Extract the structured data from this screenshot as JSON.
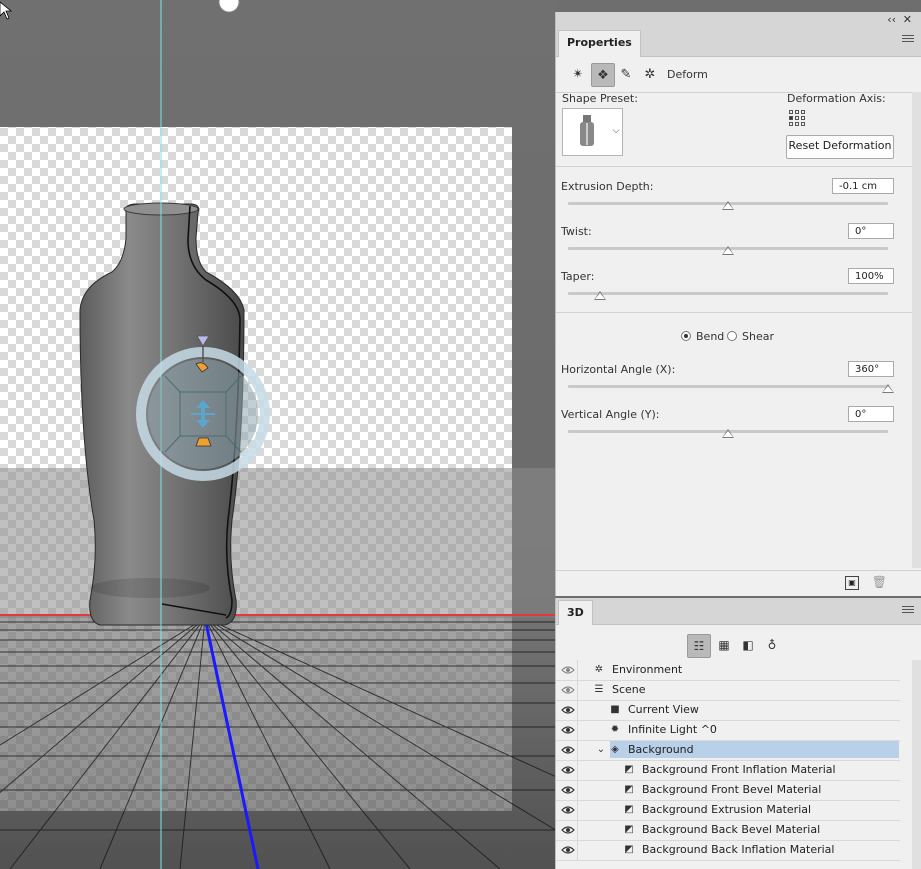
{
  "properties": {
    "tab_label": "Properties",
    "mode_label": "Deform",
    "shape_preset_label": "Shape Preset:",
    "deformation_axis_label": "Deformation Axis:",
    "reset_button": "Reset Deformation",
    "extrusion_depth": {
      "label": "Extrusion Depth:",
      "value": "-0.1 cm",
      "slider_fraction": 0.5
    },
    "twist": {
      "label": "Twist:",
      "value": "0°",
      "slider_fraction": 0.5
    },
    "taper": {
      "label": "Taper:",
      "value": "100%",
      "slider_fraction": 0.1
    },
    "bend_label": "Bend",
    "shear_label": "Shear",
    "selected_mode": "Bend",
    "horizontal_angle": {
      "label": "Horizontal Angle (X):",
      "value": "360°",
      "slider_fraction": 1.0
    },
    "vertical_angle": {
      "label": "Vertical Angle (Y):",
      "value": "0°",
      "slider_fraction": 0.5
    }
  },
  "panel3d": {
    "tab_label": "3D",
    "rows": [
      {
        "label": "Environment",
        "icon": "environment-icon",
        "indent": 0
      },
      {
        "label": "Scene",
        "icon": "scene-icon",
        "indent": 0
      },
      {
        "label": "Current View",
        "icon": "camera-icon",
        "indent": 1
      },
      {
        "label": "Infinite Light ^0",
        "icon": "light-icon",
        "indent": 1
      },
      {
        "label": "Background",
        "icon": "mesh-icon",
        "indent": 1,
        "selected": true,
        "expanded": true
      },
      {
        "label": "Background Front Inflation Material",
        "icon": "material-icon",
        "indent": 2
      },
      {
        "label": "Background Front Bevel Material",
        "icon": "material-icon",
        "indent": 2
      },
      {
        "label": "Background Extrusion Material",
        "icon": "material-icon",
        "indent": 2
      },
      {
        "label": "Background Back Bevel Material",
        "icon": "material-icon",
        "indent": 2
      },
      {
        "label": "Background Back Inflation Material",
        "icon": "material-icon",
        "indent": 2
      }
    ]
  },
  "colors": {
    "selection": "#b8d0e8",
    "guide_cyan": "#7fe6e6",
    "axis_red": "#e03a3a",
    "axis_blue": "#1a1aff",
    "panel_bg": "#f0f0f0"
  }
}
